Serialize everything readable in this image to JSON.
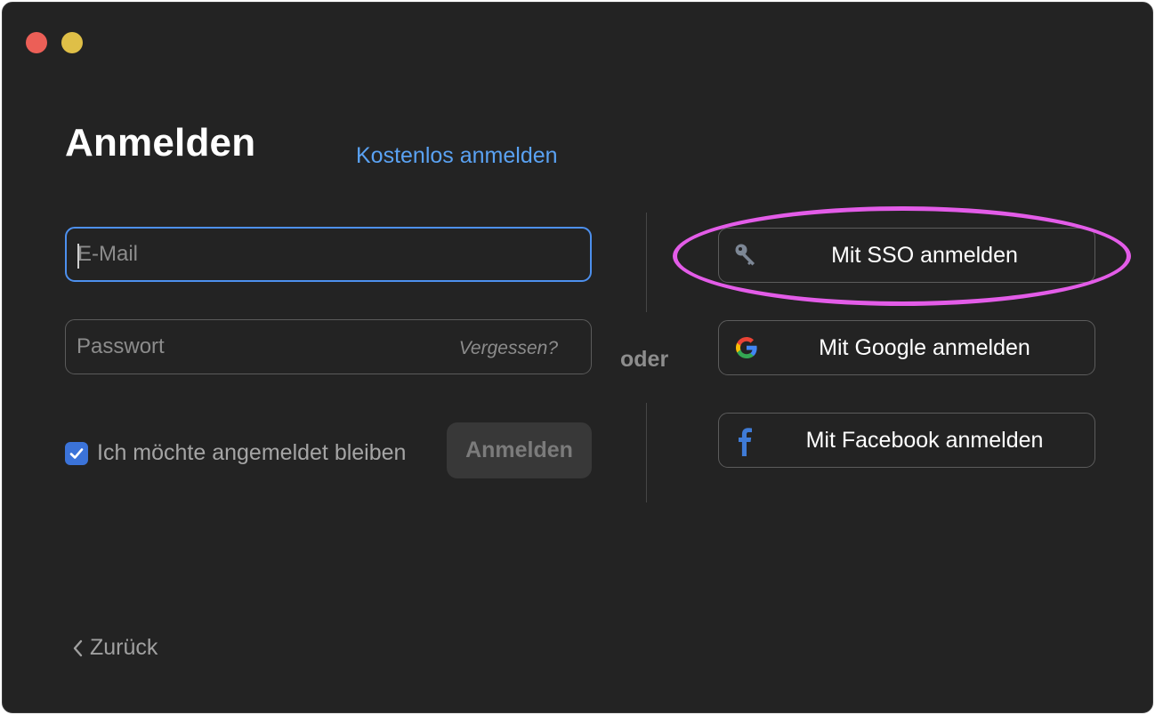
{
  "window": {
    "traffic_lights": [
      "close",
      "minimize"
    ]
  },
  "header": {
    "title": "Anmelden",
    "signup_link": "Kostenlos anmelden"
  },
  "form": {
    "email_placeholder": "E-Mail",
    "email_value": "",
    "password_placeholder": "Passwort",
    "password_value": "",
    "forgot_label": "Vergessen?",
    "remember_label": "Ich möchte angemeldet bleiben",
    "remember_checked": true,
    "submit_label": "Anmelden"
  },
  "divider": {
    "or_label": "oder"
  },
  "sso": {
    "buttons": [
      {
        "label": "Mit SSO anmelden",
        "icon": "key-icon"
      },
      {
        "label": "Mit Google anmelden",
        "icon": "google-icon"
      },
      {
        "label": "Mit Facebook anmelden",
        "icon": "facebook-icon"
      }
    ]
  },
  "footer": {
    "back_label": "Zurück"
  },
  "colors": {
    "window_bg": "#232323",
    "link": "#5aa2f3",
    "focus_border": "#4d90ee",
    "checkbox": "#3b73d9",
    "highlight": "#e35ce8"
  }
}
